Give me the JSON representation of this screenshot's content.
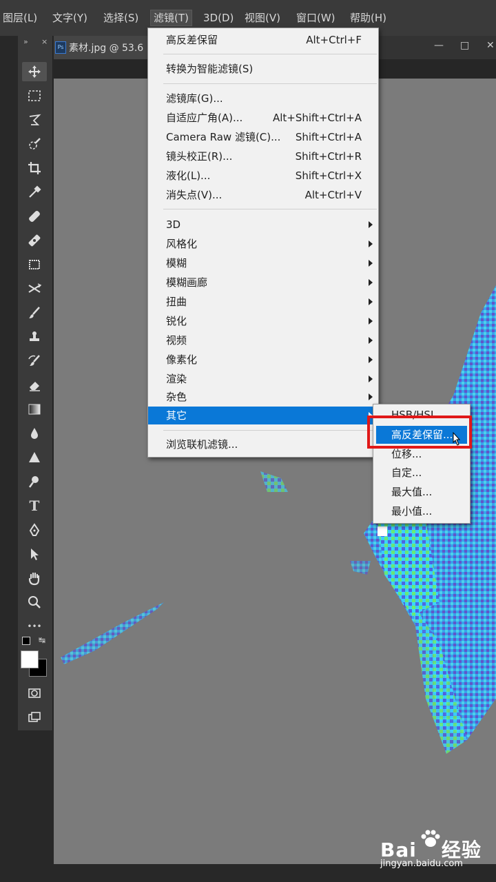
{
  "menubar": {
    "items": [
      "图层(L)",
      "文字(Y)",
      "选择(S)",
      "滤镜(T)",
      "3D(D)",
      "视图(V)",
      "窗口(W)",
      "帮助(H)"
    ],
    "active": "滤镜(T)"
  },
  "document": {
    "tab_name": "素材.jpg @ 53.6",
    "ps_badge": "Ps"
  },
  "toolbar": {
    "collapse_left": "»",
    "close": "×",
    "tools": [
      "move-tool",
      "marquee-tool",
      "lasso-tool",
      "quick-select-tool",
      "crop-tool",
      "eyedropper-tool",
      "healing-brush-tool",
      "patch-tool",
      "frame-tool",
      "content-aware-move-tool",
      "brush-tool",
      "clone-stamp-tool",
      "history-brush-tool",
      "eraser-tool",
      "gradient-tool",
      "blur-tool",
      "sharpen-tool",
      "dodge-tool",
      "type-tool",
      "pen-tool",
      "path-select-tool",
      "hand-tool",
      "zoom-tool",
      "more-tools"
    ],
    "type_glyph": "T",
    "more_glyph": "•••"
  },
  "filter_menu": {
    "top_items": [
      {
        "label": "高反差保留",
        "shortcut": "Alt+Ctrl+F"
      }
    ],
    "smart": [
      {
        "label": "转换为智能滤镜(S)",
        "shortcut": ""
      }
    ],
    "group2": [
      {
        "label": "滤镜库(G)...",
        "shortcut": ""
      },
      {
        "label": "自适应广角(A)...",
        "shortcut": "Alt+Shift+Ctrl+A"
      },
      {
        "label": "Camera Raw 滤镜(C)...",
        "shortcut": "Shift+Ctrl+A"
      },
      {
        "label": "镜头校正(R)...",
        "shortcut": "Shift+Ctrl+R"
      },
      {
        "label": "液化(L)...",
        "shortcut": "Shift+Ctrl+X"
      },
      {
        "label": "消失点(V)...",
        "shortcut": "Alt+Ctrl+V"
      }
    ],
    "submenus": [
      "3D",
      "风格化",
      "模糊",
      "模糊画廊",
      "扭曲",
      "锐化",
      "视频",
      "像素化",
      "渲染",
      "杂色",
      "其它"
    ],
    "highlighted": "其它",
    "browse": "浏览联机滤镜..."
  },
  "other_submenu": {
    "items": [
      "HSB/HSL",
      "高反差保留...",
      "位移...",
      "自定...",
      "最大值...",
      "最小值..."
    ],
    "highlighted": "高反差保留..."
  },
  "watermark": {
    "brand": "Bai",
    "brand2": "经验",
    "url": "jingyan.baidu.com"
  },
  "colors": {
    "accent": "#0a78d7",
    "highlight_box": "#e01818",
    "canvas_gray": "#7b7b7b"
  }
}
